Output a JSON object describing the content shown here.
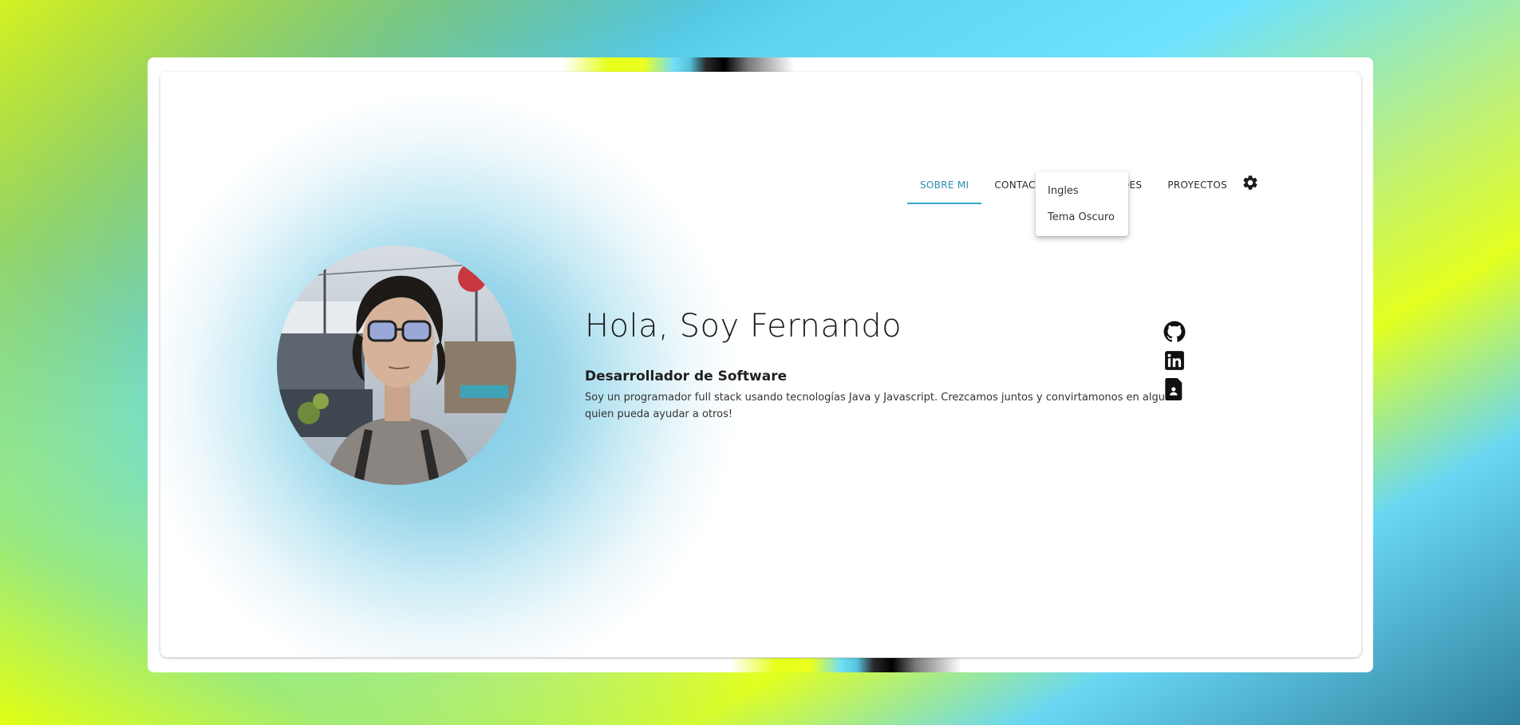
{
  "nav": {
    "tabs": [
      {
        "label": "SOBRE MI",
        "active": true
      },
      {
        "label": "CONTACTO",
        "active": false
      },
      {
        "label": "HABILIDADES",
        "active": false
      },
      {
        "label": "PROYECTOS",
        "active": false
      }
    ],
    "settings_icon": "gear-icon",
    "settings_menu": {
      "items": [
        {
          "label": "Ingles"
        },
        {
          "label": "Tema Oscuro"
        }
      ]
    }
  },
  "hero": {
    "title": "Hola, Soy Fernando",
    "subtitle": "Desarrollador de Software",
    "description": "Soy un programador full stack usando tecnologías Java y Javascript. Crezcamos juntos y convirtamonos en alguien quien pueda ayudar a otros!"
  },
  "social": {
    "icons": [
      "github-icon",
      "linkedin-icon",
      "resume-icon"
    ]
  },
  "colors": {
    "accent": "#2a8eb3",
    "accent_underline": "#36a8cf",
    "text": "#1a1a1a"
  }
}
